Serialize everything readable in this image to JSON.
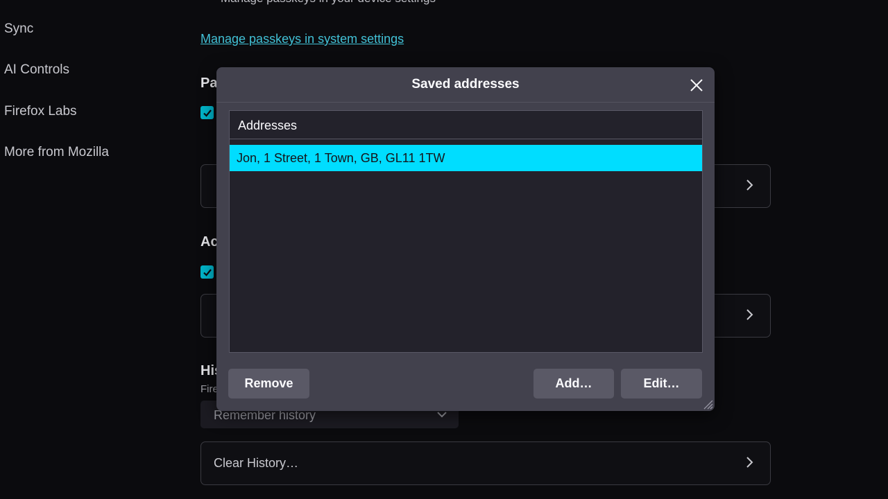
{
  "sidebar": {
    "items": [
      {
        "label": "Sync"
      },
      {
        "label": "AI Controls"
      },
      {
        "label": "Firefox Labs"
      },
      {
        "label": "More from Mozilla"
      }
    ]
  },
  "main": {
    "top_cut_text": "Manage passkeys in your device settings",
    "passkeys_link": "Manage passkeys in system settings",
    "section_fragments": [
      "Pa",
      "Ac",
      "His"
    ],
    "history_desc_fragment": "Fire",
    "history_select_value": "Remember history",
    "clear_history_label": "Clear History…"
  },
  "dialog": {
    "title": "Saved addresses",
    "list_header": "Addresses",
    "addresses": [
      "Jon, 1 Street, 1 Town, GB, GL11 1TW"
    ],
    "remove_label": "Remove",
    "add_label": "Add…",
    "edit_label": "Edit…"
  },
  "colors": {
    "accent": "#00ddff",
    "checkbox": "#00b3c8",
    "link": "#42c1d6",
    "dialog_bg": "#42414d"
  }
}
